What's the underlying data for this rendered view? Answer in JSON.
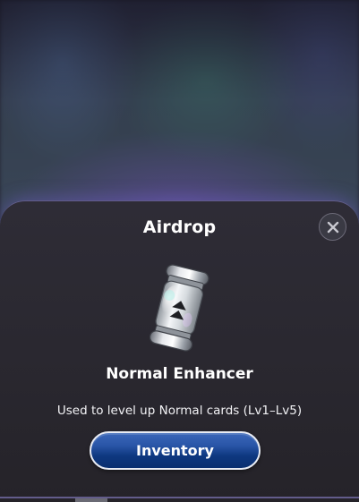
{
  "modal": {
    "title": "Airdrop",
    "item_name": "Normal Enhancer",
    "item_description": "Used to level up Normal cards (Lv1–Lv5)",
    "primary_button_label": "Inventory",
    "close_icon": "close-icon",
    "item_icon": "enhancer-canister-icon"
  },
  "colors": {
    "sheet_background": "#2a2830",
    "button_blue": "#1a4594",
    "accent_glow": "#7864dc",
    "text": "#ffffff"
  }
}
